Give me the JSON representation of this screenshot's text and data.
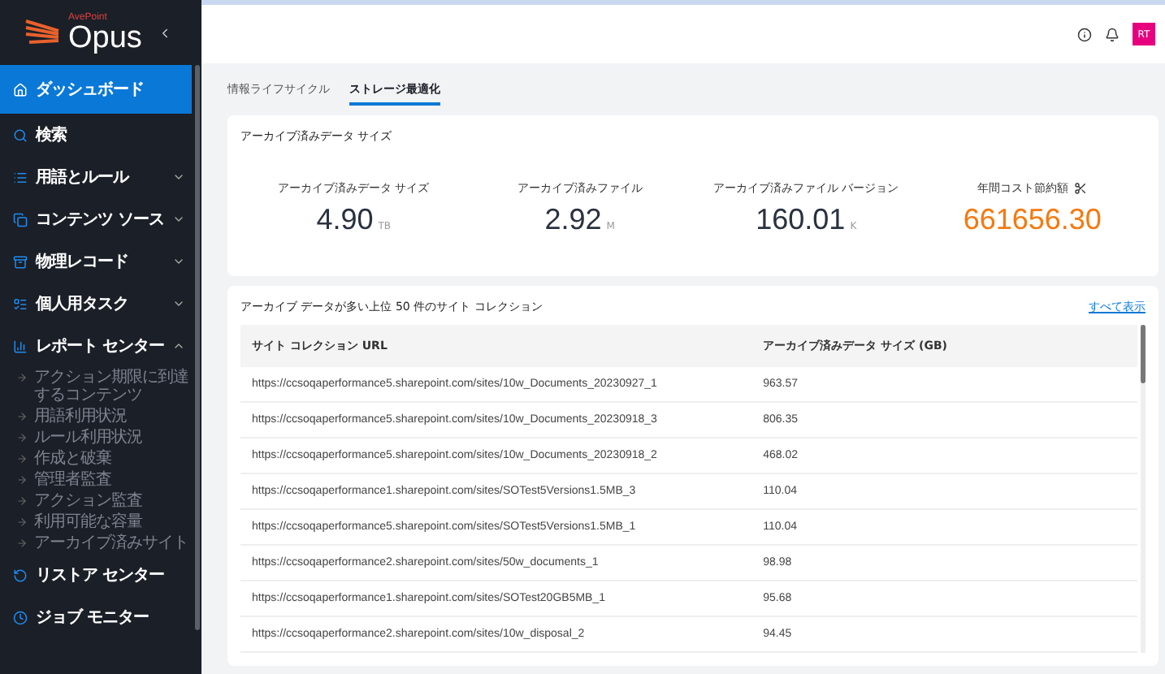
{
  "logo": {
    "brand": "AvePoint",
    "name": "Opus"
  },
  "sidebar": {
    "items": [
      {
        "label": "ダッシュボード",
        "kind": "link",
        "selected": true
      },
      {
        "label": "検索",
        "kind": "link",
        "selected": false
      },
      {
        "label": "用語とルール",
        "kind": "group",
        "selected": false,
        "expanded": false
      },
      {
        "label": "コンテンツ ソース",
        "kind": "group",
        "selected": false,
        "expanded": false
      },
      {
        "label": "物理レコード",
        "kind": "group",
        "selected": false,
        "expanded": false
      },
      {
        "label": "個人用タスク",
        "kind": "group",
        "selected": false,
        "expanded": false
      },
      {
        "label": "レポート センター",
        "kind": "group",
        "selected": false,
        "expanded": true,
        "children": [
          {
            "label": "アクション期限に到達するコンテンツ"
          },
          {
            "label": "用語利用状況"
          },
          {
            "label": "ルール利用状況"
          },
          {
            "label": "作成と破棄"
          },
          {
            "label": "管理者監査"
          },
          {
            "label": "アクション監査"
          },
          {
            "label": "利用可能な容量"
          },
          {
            "label": "アーカイブ済みサイト"
          }
        ]
      },
      {
        "label": "リストア センター",
        "kind": "link",
        "selected": false
      },
      {
        "label": "ジョブ モニター",
        "kind": "link",
        "selected": false
      }
    ]
  },
  "header": {
    "avatar": "RT"
  },
  "tabs": [
    {
      "label": "情報ライフサイクル",
      "selected": false
    },
    {
      "label": "ストレージ最適化",
      "selected": true
    }
  ],
  "summary": {
    "title": "アーカイブ済みデータ サイズ",
    "metrics": [
      {
        "kind": "stat",
        "label": "アーカイブ済みデータ サイズ",
        "value": "4.90",
        "unit": "TB"
      },
      {
        "kind": "stat",
        "label": "アーカイブ済みファイル",
        "value": "2.92",
        "unit": "M"
      },
      {
        "kind": "stat",
        "label": "アーカイブ済みファイル バージョン",
        "value": "160.01",
        "unit": "K"
      },
      {
        "kind": "cost",
        "label": "年間コスト節約額",
        "value": "661656.30"
      }
    ]
  },
  "top_sites": {
    "title": "アーカイブ データが多い上位 50 件のサイト コレクション",
    "link": "すべて表示",
    "columns": [
      "サイト コレクション URL",
      "アーカイブ済みデータ サイズ (GB)"
    ],
    "rows": [
      [
        "https://ccsoqaperformance5.sharepoint.com/sites/10w_Documents_20230927_1",
        "963.57"
      ],
      [
        "https://ccsoqaperformance5.sharepoint.com/sites/10w_Documents_20230918_3",
        "806.35"
      ],
      [
        "https://ccsoqaperformance5.sharepoint.com/sites/10w_Documents_20230918_2",
        "468.02"
      ],
      [
        "https://ccsoqaperformance1.sharepoint.com/sites/SOTest5Versions1.5MB_3",
        "110.04"
      ],
      [
        "https://ccsoqaperformance5.sharepoint.com/sites/SOTest5Versions1.5MB_1",
        "110.04"
      ],
      [
        "https://ccsoqaperformance2.sharepoint.com/sites/50w_documents_1",
        "98.98"
      ],
      [
        "https://ccsoqaperformance1.sharepoint.com/sites/SOTest20GB5MB_1",
        "95.68"
      ],
      [
        "https://ccsoqaperformance2.sharepoint.com/sites/10w_disposal_2",
        "94.45"
      ]
    ]
  }
}
